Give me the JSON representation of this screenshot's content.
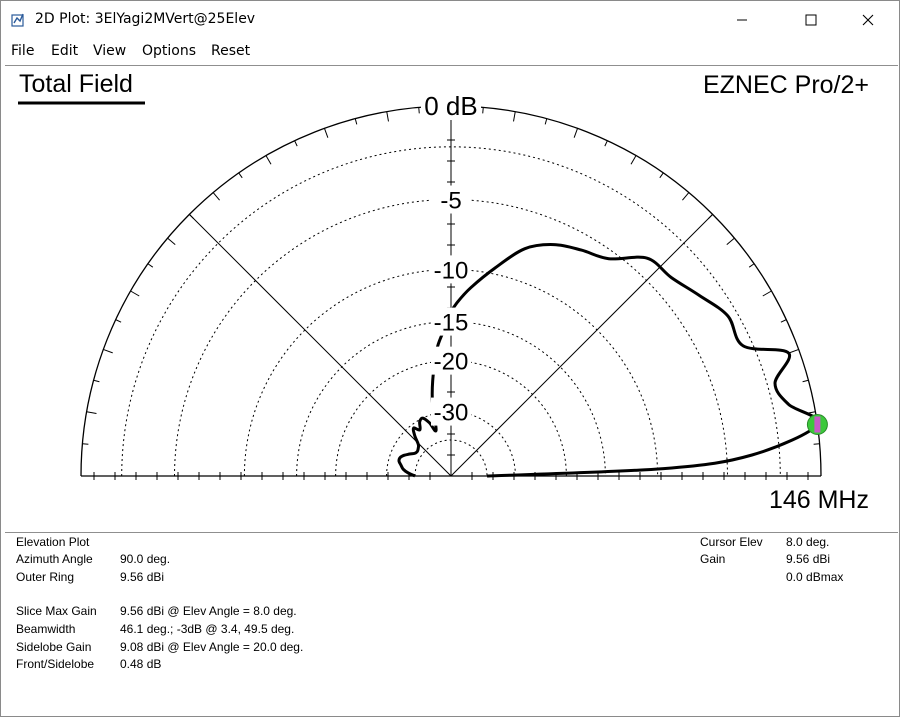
{
  "window": {
    "title": "2D Plot: 3ElYagi2MVert@25Elev"
  },
  "menu": [
    "File",
    "Edit",
    "View",
    "Options",
    "Reset"
  ],
  "plot": {
    "heading": "Total Field",
    "brand": "EZNEC Pro/2+",
    "frequency": "146 MHz",
    "ring_labels": [
      "0 dB",
      "-5",
      "-10",
      "-15",
      "-20",
      "-30"
    ],
    "curve_color": "#000000",
    "cursor_color": "#3cc83c",
    "cursor_marker_color": "#c85ac8"
  },
  "chart_data": {
    "type": "polar",
    "scale": "ARRL log",
    "outer_ring_dBi": 9.56,
    "ring_values_dB": [
      0,
      -5,
      -10,
      -15,
      -20,
      -30
    ],
    "pattern": {
      "elev_deg": [
        0,
        2,
        4,
        8,
        12,
        16,
        20,
        24,
        30,
        36,
        42,
        48,
        54,
        60,
        66,
        72,
        78,
        84,
        88,
        90,
        92,
        96,
        100,
        104,
        108,
        112,
        116,
        120,
        124,
        128,
        132,
        136,
        140,
        144,
        148,
        152,
        156,
        160,
        164,
        168,
        172,
        176,
        180
      ],
      "gain_dB": [
        -40,
        -9.5,
        -3.5,
        0,
        -1.2,
        -1.6,
        -0.5,
        -2.5,
        -2.5,
        -3.2,
        -3.8,
        -4.0,
        -5.5,
        -6.0,
        -6.5,
        -7.5,
        -9.5,
        -11.5,
        -13.0,
        -14.0,
        -15.5,
        -18.0,
        -22.0,
        -27.0,
        -35.0,
        -32.0,
        -30.0,
        -30.5,
        -32.5,
        -31.0,
        -33.0,
        -36.0,
        -37.0,
        -37.5,
        -37.0,
        -35.5,
        -34.0,
        -33.0,
        -33.0,
        -34.0,
        -35.0,
        -37.0,
        -40
      ]
    },
    "cursor": {
      "elev_deg": 8.0,
      "gain_dBi": 9.56,
      "dBmax": 0.0
    }
  },
  "info": {
    "left": [
      {
        "label": "Elevation Plot",
        "value": ""
      },
      {
        "label": "Azimuth Angle",
        "value": "90.0 deg."
      },
      {
        "label": "Outer Ring",
        "value": "9.56 dBi"
      },
      {
        "label": "Slice Max Gain",
        "value": "9.56 dBi @ Elev Angle = 8.0 deg."
      },
      {
        "label": "Beamwidth",
        "value": "46.1 deg.; -3dB @ 3.4, 49.5 deg."
      },
      {
        "label": "Sidelobe Gain",
        "value": "9.08 dBi @ Elev Angle = 20.0 deg."
      },
      {
        "label": "Front/Sidelobe",
        "value": "0.48 dB"
      }
    ],
    "right": {
      "cursor_label": "Cursor Elev",
      "cursor_value": "8.0 deg.",
      "gain_label": "Gain",
      "gain_value": "9.56 dBi",
      "dbmax_value": "0.0 dBmax"
    }
  }
}
